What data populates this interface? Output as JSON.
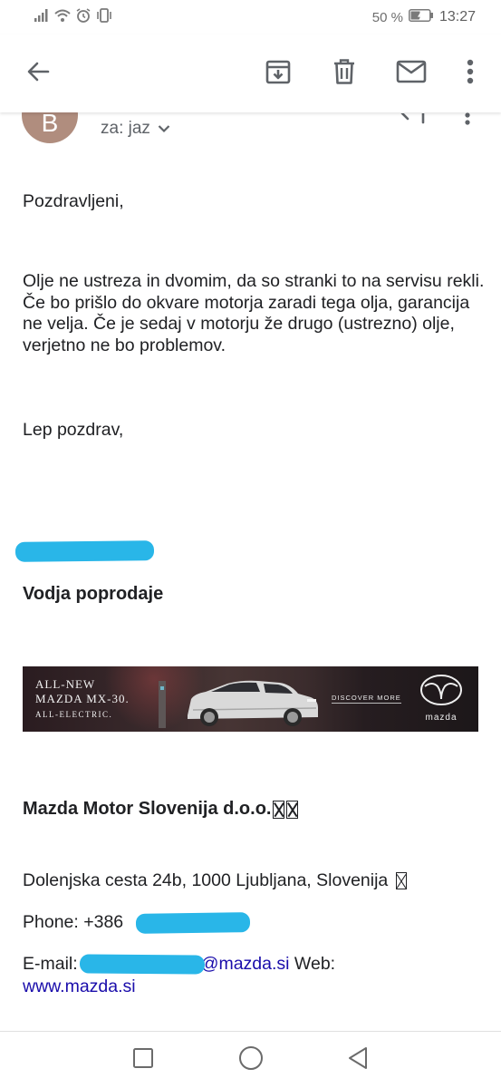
{
  "status_bar": {
    "battery_percent": "50 %",
    "time": "13:27",
    "battery_level": 0.5
  },
  "app_bar": {
    "icons": [
      "back-arrow-icon",
      "archive-icon",
      "delete-icon",
      "mail-icon",
      "more-vert-icon"
    ]
  },
  "message_header": {
    "avatar_letter": "B",
    "recipient": "za: jaz"
  },
  "message": {
    "greeting": "Pozdravljeni,",
    "paragraph": "Olje ne ustreza in dvomim, da so stranki to na servisu rekli. Če bo prišlo do okvare motorja zaradi tega olja, garancija ne velja. Če je sedaj v motorju že drugo (ustrezno) olje, verjetno ne bo problemov.",
    "closing": "Lep pozdrav,"
  },
  "signature": {
    "role": "Vodja poprodaje",
    "company": "Mazda Motor Slovenija d.o.o.",
    "address": "Dolenjska cesta 24b, 1000 Ljubljana, Slovenija",
    "phone_prefix": "Phone: +386",
    "email_prefix": "E-mail:",
    "email_domain": "@mazda.si",
    "web_label": " Web:",
    "web_link": "www.mazda.si"
  },
  "banner": {
    "line1": "ALL-NEW",
    "line2": "MAZDA MX-30.",
    "line3": "ALL-ELECTRIC.",
    "cta": "DISCOVER MORE",
    "logo_word": "mazda"
  },
  "colors": {
    "redaction": "#29b6e8",
    "link": "#1a0dab",
    "avatar": "#b08d7e"
  }
}
